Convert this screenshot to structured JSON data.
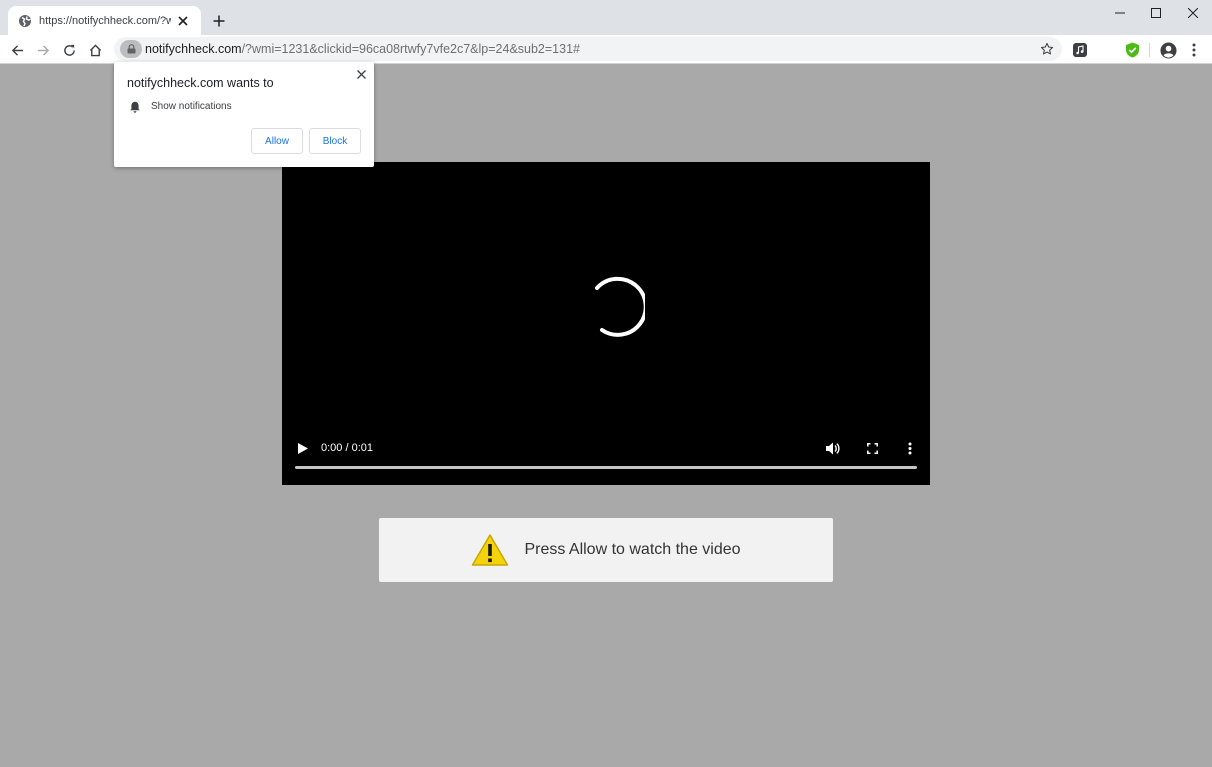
{
  "browser": {
    "tab": {
      "title": "https://notifychheck.com/?wmi="
    },
    "address": {
      "host": "notifychheck.com",
      "path": "/?wmi=1231&clickid=96ca08rtwfy7vfe2c7&lp=24&sub2=131#"
    },
    "extension_colors": {
      "shield": "#4cbb17"
    }
  },
  "permission_prompt": {
    "title": "notifychheck.com wants to",
    "permission": "Show notifications",
    "allow_label": "Allow",
    "block_label": "Block"
  },
  "video": {
    "time_display": "0:00 / 0:01",
    "progress": 0
  },
  "notice": {
    "text": "Press Allow to watch the video",
    "icon": "warning-icon",
    "icon_color": "#f4d20c"
  },
  "colors": {
    "page_background": "#a9a9a9",
    "accent": "#1a73e8"
  }
}
